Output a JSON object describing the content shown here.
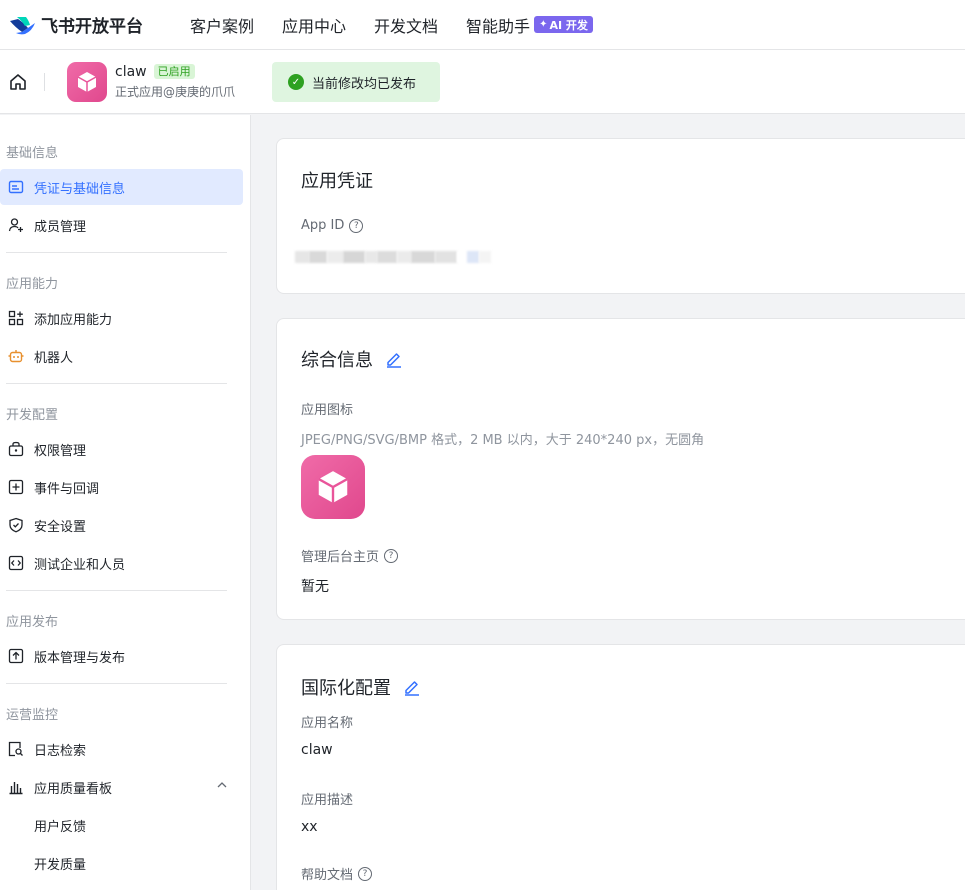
{
  "topnav": {
    "brand": "飞书开放平台",
    "links": [
      "客户案例",
      "应用中心",
      "开发文档",
      "智能助手"
    ],
    "ai_badge": "AI 开发"
  },
  "appbar": {
    "app_name": "claw",
    "status": "已启用",
    "subtitle": "正式应用@庚庚的爪爪",
    "publish_status": "当前修改均已发布"
  },
  "sidebar": {
    "sections": [
      {
        "title": "基础信息",
        "items": [
          "凭证与基础信息",
          "成员管理"
        ]
      },
      {
        "title": "应用能力",
        "items": [
          "添加应用能力",
          "机器人"
        ]
      },
      {
        "title": "开发配置",
        "items": [
          "权限管理",
          "事件与回调",
          "安全设置",
          "测试企业和人员"
        ]
      },
      {
        "title": "应用发布",
        "items": [
          "版本管理与发布"
        ]
      },
      {
        "title": "运营监控",
        "items": [
          "日志检索",
          "应用质量看板",
          "用户反馈",
          "开发质量"
        ]
      }
    ]
  },
  "credentials": {
    "title": "应用凭证",
    "app_id_label": "App ID"
  },
  "general": {
    "title": "综合信息",
    "icon_label": "应用图标",
    "icon_hint": "JPEG/PNG/SVG/BMP 格式，2 MB 以内，大于 240*240 px，无圆角",
    "admin_home_label": "管理后台主页",
    "admin_home_value": "暂无"
  },
  "i18n": {
    "title": "国际化配置",
    "name_label": "应用名称",
    "name_value": "claw",
    "desc_label": "应用描述",
    "desc_value": "xx",
    "help_label": "帮助文档"
  },
  "colors": {
    "accent": "#3370ff",
    "app_icon": "#e9559a",
    "success": "#2ea121",
    "ai_badge": "#7b67ee"
  }
}
